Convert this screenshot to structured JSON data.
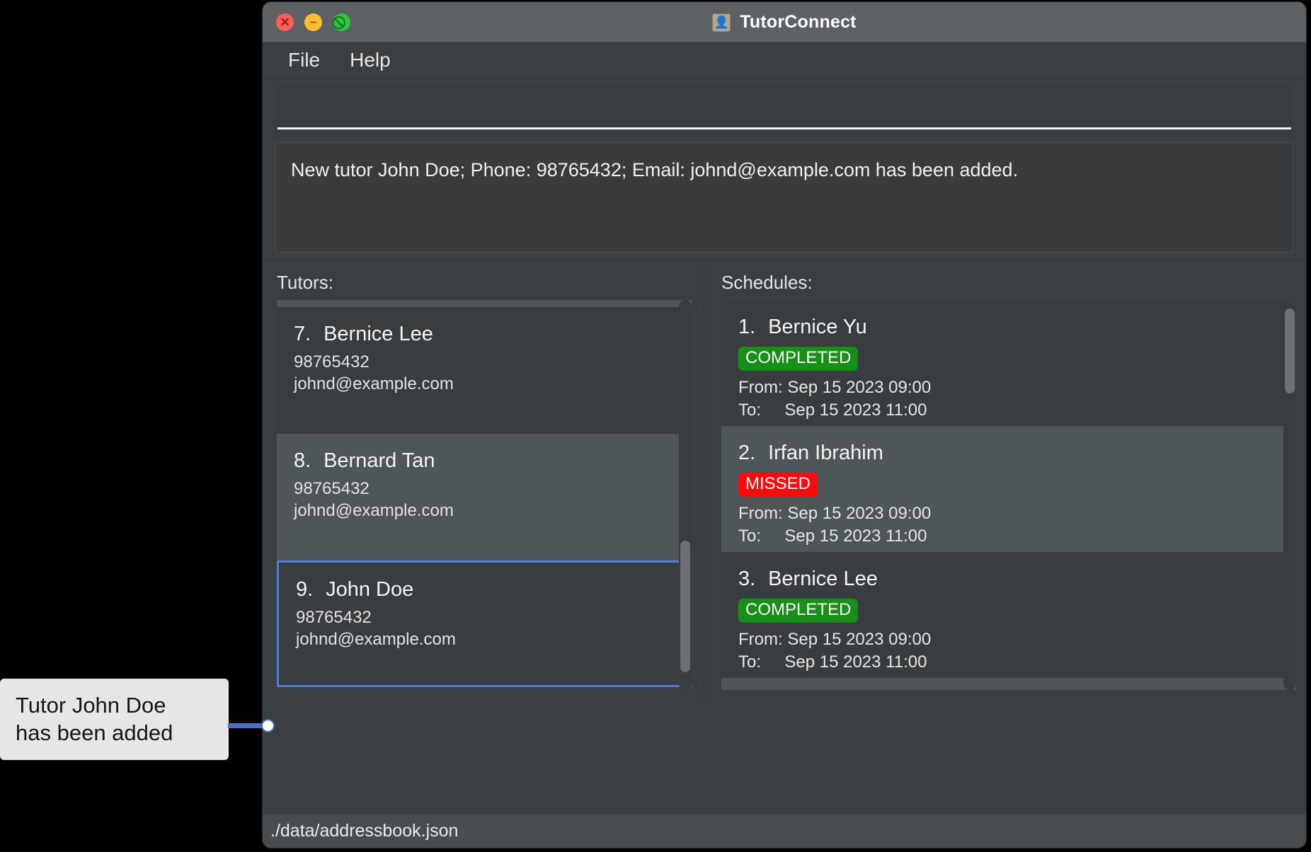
{
  "window": {
    "title": "TutorConnect",
    "app_icon": "contact-person-icon",
    "controls": {
      "close": "close-icon",
      "minimize": "minimize-icon",
      "maximize": "maximize-icon"
    }
  },
  "menubar": {
    "items": [
      {
        "label": "File"
      },
      {
        "label": "Help"
      }
    ]
  },
  "command": {
    "value": "",
    "placeholder": ""
  },
  "result": {
    "message": "New tutor John Doe; Phone: 98765432; Email: johnd@example.com has been added."
  },
  "tutors_panel": {
    "heading": "Tutors:",
    "items": [
      {
        "index": "7.",
        "name": "Bernice Lee",
        "phone": "98765432",
        "email": "johnd@example.com",
        "selected": false
      },
      {
        "index": "8.",
        "name": "Bernard Tan",
        "phone": "98765432",
        "email": "johnd@example.com",
        "selected": false
      },
      {
        "index": "9.",
        "name": "John Doe",
        "phone": "98765432",
        "email": "johnd@example.com",
        "selected": true
      }
    ]
  },
  "schedules_panel": {
    "heading": "Schedules:",
    "labels": {
      "from": "From:",
      "to": "To:"
    },
    "items": [
      {
        "index": "1.",
        "name": "Bernice Yu",
        "status": "COMPLETED",
        "status_kind": "completed",
        "from": "Sep 15 2023 09:00",
        "to": "Sep 15 2023 11:00"
      },
      {
        "index": "2.",
        "name": "Irfan Ibrahim",
        "status": "MISSED",
        "status_kind": "missed",
        "from": "Sep 15 2023 09:00",
        "to": "Sep 15 2023 11:00"
      },
      {
        "index": "3.",
        "name": "Bernice Lee",
        "status": "COMPLETED",
        "status_kind": "completed",
        "from": "Sep 15 2023 09:00",
        "to": "Sep 15 2023 11:00"
      }
    ]
  },
  "statusbar": {
    "path": "./data/addressbook.json"
  },
  "callout": {
    "line1": "Tutor John Doe",
    "line2": "has been added"
  },
  "colors": {
    "accent_selection": "#4d7fd4",
    "status_completed": "#169016",
    "status_missed": "#fa0a0a",
    "callout_connector": "#4a72c4"
  }
}
